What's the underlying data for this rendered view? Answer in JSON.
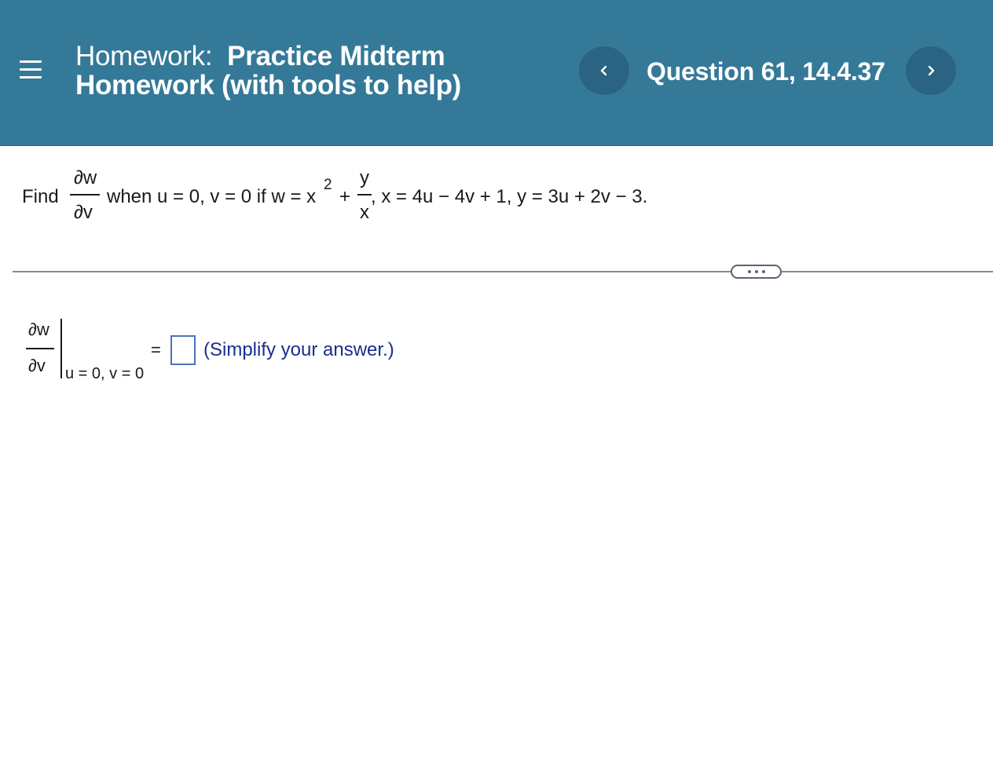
{
  "header": {
    "menu_icon": "hamburger-menu-icon",
    "homework_label": "Homework:",
    "homework_name_line1": "Practice Midterm",
    "homework_name_line2": "Homework (with tools to help)",
    "question_title": "Question 61, 14.4.37",
    "prev_icon": "chevron-left-icon",
    "next_icon": "chevron-right-icon"
  },
  "problem": {
    "find": "Find",
    "dw": "∂w",
    "dv": "∂v",
    "when_text": "when u = 0, v = 0 if w = x",
    "exp": "2",
    "plus": "+",
    "y": "y",
    "x": "x",
    "rest": ", x = 4u − 4v + 1, y = 3u + 2v − 3."
  },
  "divider": {
    "more_icon": "more-options-icon"
  },
  "answer": {
    "dw": "∂w",
    "dv": "∂v",
    "eval_at": "u = 0, v = 0",
    "equals": "=",
    "value": "",
    "hint": "(Simplify your answer.)"
  },
  "colors": {
    "header_bg": "#357998",
    "nav_button_bg": "#2a6482",
    "hint_text": "#1b2e8a",
    "answer_box_border": "#4a74b8"
  }
}
